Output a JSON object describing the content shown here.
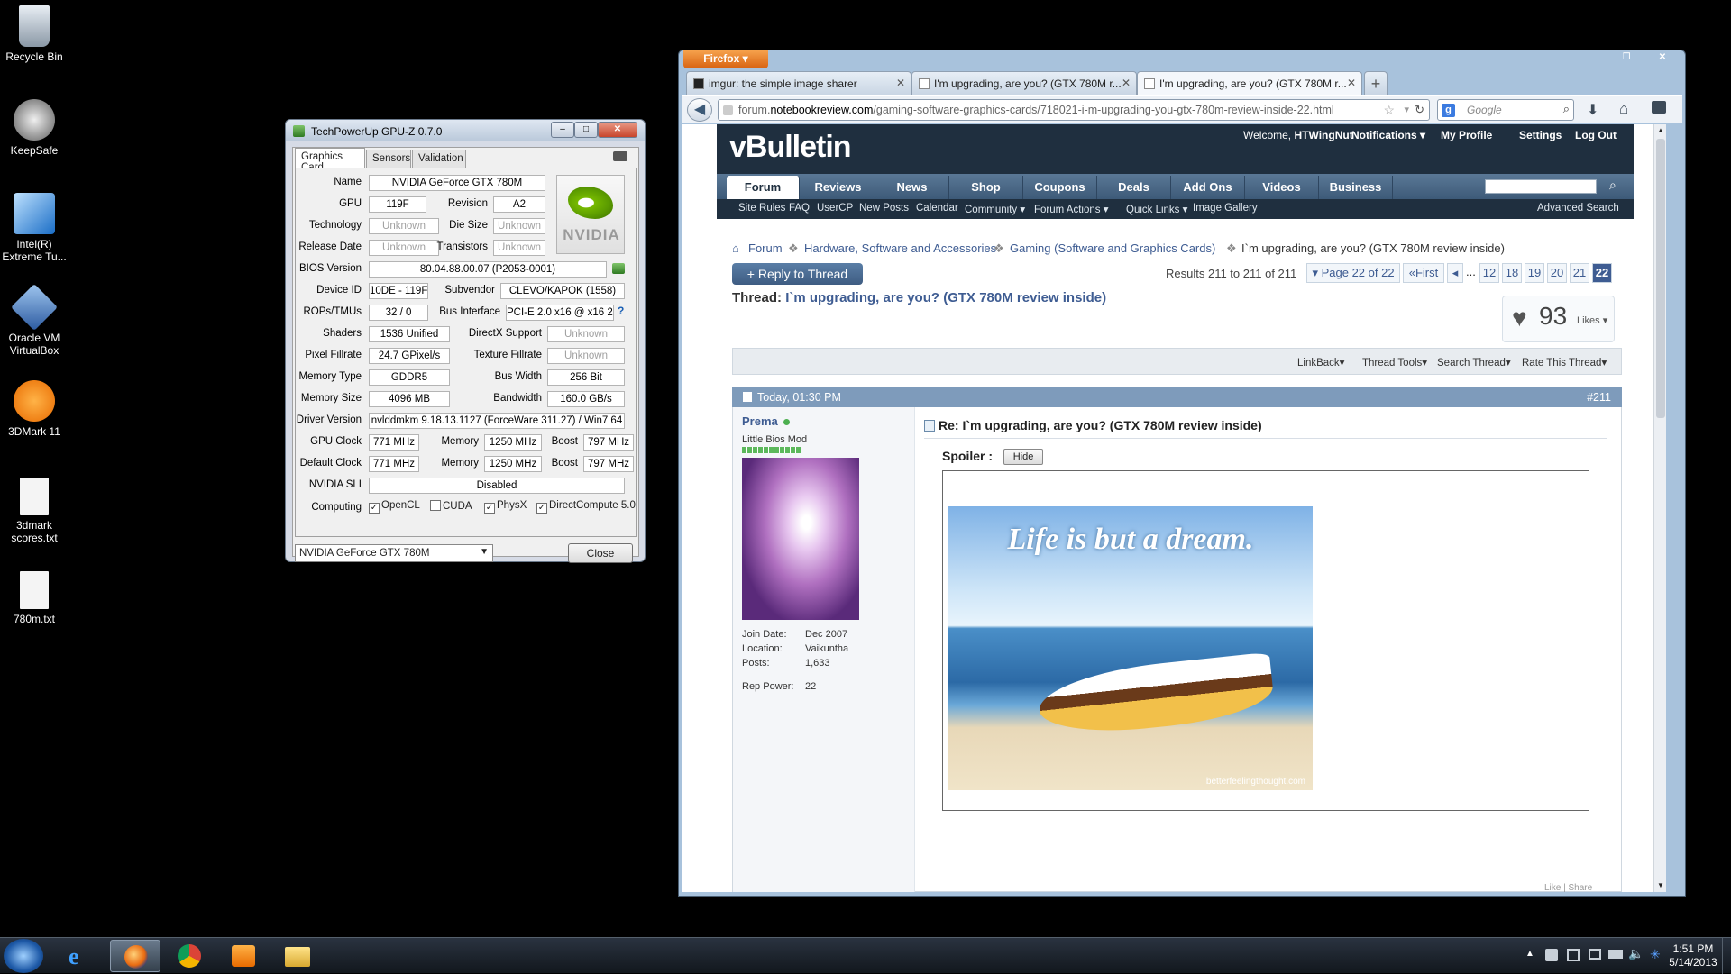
{
  "desktop": {
    "icons": [
      {
        "label": "Recycle Bin"
      },
      {
        "label": "KeepSafe"
      },
      {
        "label": "Intel(R) Extreme Tu..."
      },
      {
        "label": "Oracle VM VirtualBox"
      },
      {
        "label": "3DMark 11"
      },
      {
        "label": "3dmark scores.txt"
      },
      {
        "label": "780m.txt"
      }
    ]
  },
  "taskbar": {
    "time": "1:51 PM",
    "date": "5/14/2013"
  },
  "gpuz": {
    "title": "TechPowerUp GPU-Z 0.7.0",
    "tabs": [
      "Graphics Card",
      "Sensors",
      "Validation"
    ],
    "labels": {
      "name": "Name",
      "gpu": "GPU",
      "revision": "Revision",
      "technology": "Technology",
      "die_size": "Die Size",
      "release_date": "Release Date",
      "transistors": "Transistors",
      "bios": "BIOS Version",
      "device_id": "Device ID",
      "subvendor": "Subvendor",
      "rops": "ROPs/TMUs",
      "bus_interface": "Bus Interface",
      "shaders": "Shaders",
      "directx": "DirectX Support",
      "pixel_fillrate": "Pixel Fillrate",
      "texture_fillrate": "Texture Fillrate",
      "memory_type": "Memory Type",
      "bus_width": "Bus Width",
      "memory_size": "Memory Size",
      "bandwidth": "Bandwidth",
      "driver": "Driver Version",
      "gpu_clock": "GPU Clock",
      "memory": "Memory",
      "boost": "Boost",
      "default_clock": "Default Clock",
      "sli": "NVIDIA SLI",
      "computing": "Computing"
    },
    "values": {
      "name": "NVIDIA GeForce GTX 780M",
      "gpu": "119F",
      "revision": "A2",
      "technology": "Unknown",
      "die_size": "Unknown",
      "release_date": "Unknown",
      "transistors": "Unknown",
      "bios": "80.04.88.00.07 (P2053-0001)",
      "device_id": "10DE - 119F",
      "subvendor": "CLEVO/KAPOK (1558)",
      "rops": "32 / 0",
      "bus_interface": "PCI-E 2.0 x16 @ x16 2.0",
      "bus_help": "?",
      "shaders": "1536 Unified",
      "directx": "Unknown",
      "pixel_fillrate": "24.7 GPixel/s",
      "texture_fillrate": "Unknown",
      "memory_type": "GDDR5",
      "bus_width": "256 Bit",
      "memory_size": "4096 MB",
      "bandwidth": "160.0 GB/s",
      "driver": "nvlddmkm 9.18.13.1127 (ForceWare 311.27) / Win7 64",
      "gpu_clock": "771 MHz",
      "gpu_mem": "1250 MHz",
      "gpu_boost": "797 MHz",
      "def_clock": "771 MHz",
      "def_mem": "1250 MHz",
      "def_boost": "797 MHz",
      "sli": "Disabled"
    },
    "computing": [
      {
        "label": "OpenCL",
        "checked": true
      },
      {
        "label": "CUDA",
        "checked": false
      },
      {
        "label": "PhysX",
        "checked": true
      },
      {
        "label": "DirectCompute 5.0",
        "checked": true
      }
    ],
    "logo_text": "NVIDIA",
    "select_value": "NVIDIA GeForce GTX 780M",
    "close_label": "Close"
  },
  "firefox": {
    "menu_label": "Firefox",
    "tabs": [
      {
        "label": "imgur: the simple image sharer"
      },
      {
        "label": "I'm upgrading, are you? (GTX 780M r..."
      },
      {
        "label": "I'm upgrading, are you? (GTX 780M r..."
      }
    ],
    "url_prefix": "forum.",
    "url_domain": "notebookreview.com",
    "url_rest": "/gaming-software-graphics-cards/718021-i-m-upgrading-you-gtx-780m-review-inside-22.html",
    "search_placeholder": "Google"
  },
  "forum": {
    "logo": "vBulletin",
    "welcome": "Welcome,",
    "username": "HTWingNut",
    "top_links": [
      "Notifications",
      "My Profile",
      "Settings",
      "Log Out"
    ],
    "nav_tabs": [
      "Forum",
      "Reviews",
      "News",
      "Shop",
      "Coupons",
      "Deals",
      "Add Ons",
      "Videos",
      "Business"
    ],
    "sub_links": [
      "Site Rules",
      "FAQ",
      "UserCP",
      "New Posts",
      "Calendar",
      "Community",
      "Forum Actions",
      "Quick Links",
      "Image Gallery"
    ],
    "advanced_search": "Advanced Search",
    "breadcrumb": [
      "Forum",
      "Hardware, Software and Accessories",
      "Gaming (Software and Graphics Cards)",
      "I`m upgrading, are you? (GTX 780M review inside)"
    ],
    "reply_button": "+ Reply to Thread",
    "results": "Results 211 to 211 of 211",
    "page_of": "Page 22 of 22",
    "first": "First",
    "ellipsis": "...",
    "pages": [
      "12",
      "18",
      "19",
      "20",
      "21",
      "22"
    ],
    "thread_label": "Thread:",
    "thread_title": "I`m upgrading, are you? (GTX 780M review inside)",
    "likes_count": "93",
    "likes_label": "Likes",
    "thread_tools": [
      "LinkBack",
      "Thread Tools",
      "Search Thread",
      "Rate This Thread"
    ],
    "post": {
      "date": "Today, 01:30 PM",
      "number": "#211",
      "author": "Prema",
      "user_title": "Little Bios Mod",
      "join_label": "Join Date:",
      "join_value": "Dec 2007",
      "location_label": "Location:",
      "location_value": "Vaikuntha",
      "posts_label": "Posts:",
      "posts_value": "1,633",
      "rep_label": "Rep Power:",
      "rep_value": "22",
      "title": "Re: I`m upgrading, are you? (GTX 780M review inside)",
      "spoiler_label": "Spoiler :",
      "hide_button": "Hide",
      "image_caption": "Life is but a dream.",
      "image_credit": "betterfeelingthought.com",
      "footer": "Like | Share"
    }
  }
}
